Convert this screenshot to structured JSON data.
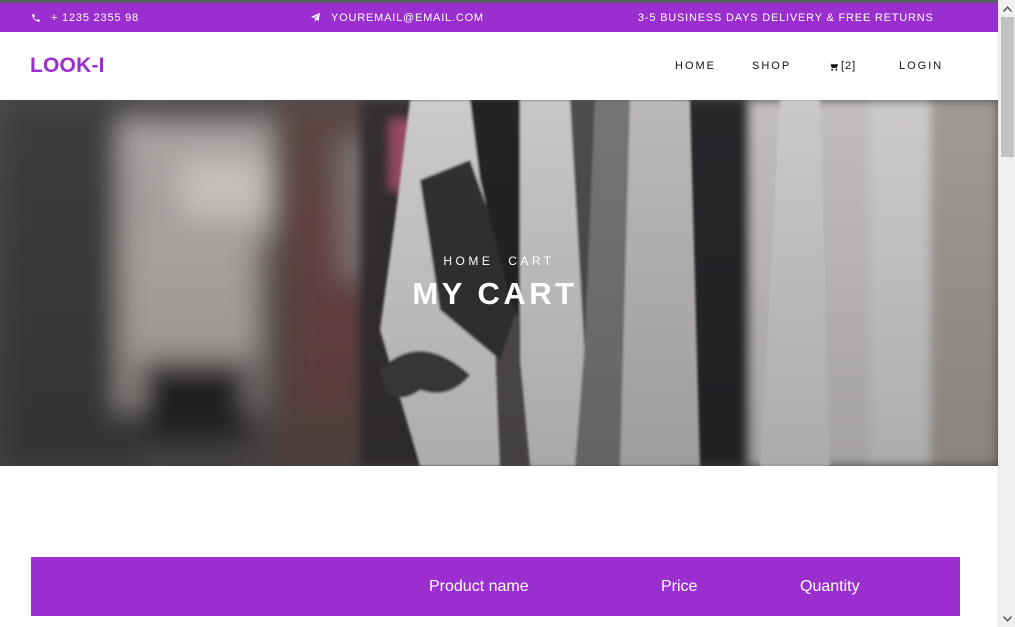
{
  "topbar": {
    "phone": "+ 1235 2355 98",
    "email": "YOUREMAIL@EMAIL.COM",
    "delivery": "3-5 BUSINESS DAYS DELIVERY & FREE RETURNS"
  },
  "header": {
    "logo": "LOOK-I",
    "nav": {
      "home": "HOME",
      "shop": "SHOP",
      "cart_count": "[2]",
      "login": "LOGIN"
    }
  },
  "hero": {
    "breadcrumb": [
      "HOME",
      "CART"
    ],
    "title": "MY CART"
  },
  "cart_table": {
    "columns": [
      "Product name",
      "Price",
      "Quantity"
    ]
  },
  "icons": {
    "phone": "phone-icon",
    "email": "paper-plane-icon",
    "cart": "cart-icon"
  },
  "colors": {
    "accent": "#9a2ecf",
    "text": "#111111",
    "white": "#ffffff"
  }
}
